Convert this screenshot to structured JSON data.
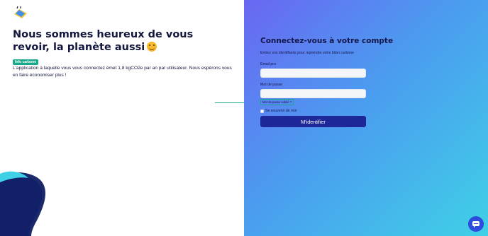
{
  "left_panel": {
    "headline": "Nous sommes heureux de vous revoir, la planète aussi",
    "emoji_icon": "hugging-face-emoji",
    "badge": "Info carbone",
    "info_text": "L'application à laquelle vous vous connectez émet 1,8 kgCO2e par an par utilisateur. Nous espérons vous en faire économiser plus !",
    "logo_icon": "app-logo"
  },
  "login_form": {
    "title": "Connectez-vous à votre compte",
    "subtitle": "Entrez vos identifiants pour reprendre votre bilan carbone",
    "email_label": "Email pro",
    "email_value": "",
    "password_label": "Mot de passe",
    "password_value": "",
    "forgot_password": "Mot de passe oublié ?",
    "remember_me": "Se souvenir de moi",
    "submit_label": "M'identifier"
  },
  "chat": {
    "icon": "chat-bubble-icon"
  },
  "colors": {
    "navy": "#13173d",
    "teal": "#17a88b",
    "button": "#1e2797",
    "gradient_start": "#6a66f2",
    "gradient_end": "#3fd0e6"
  }
}
